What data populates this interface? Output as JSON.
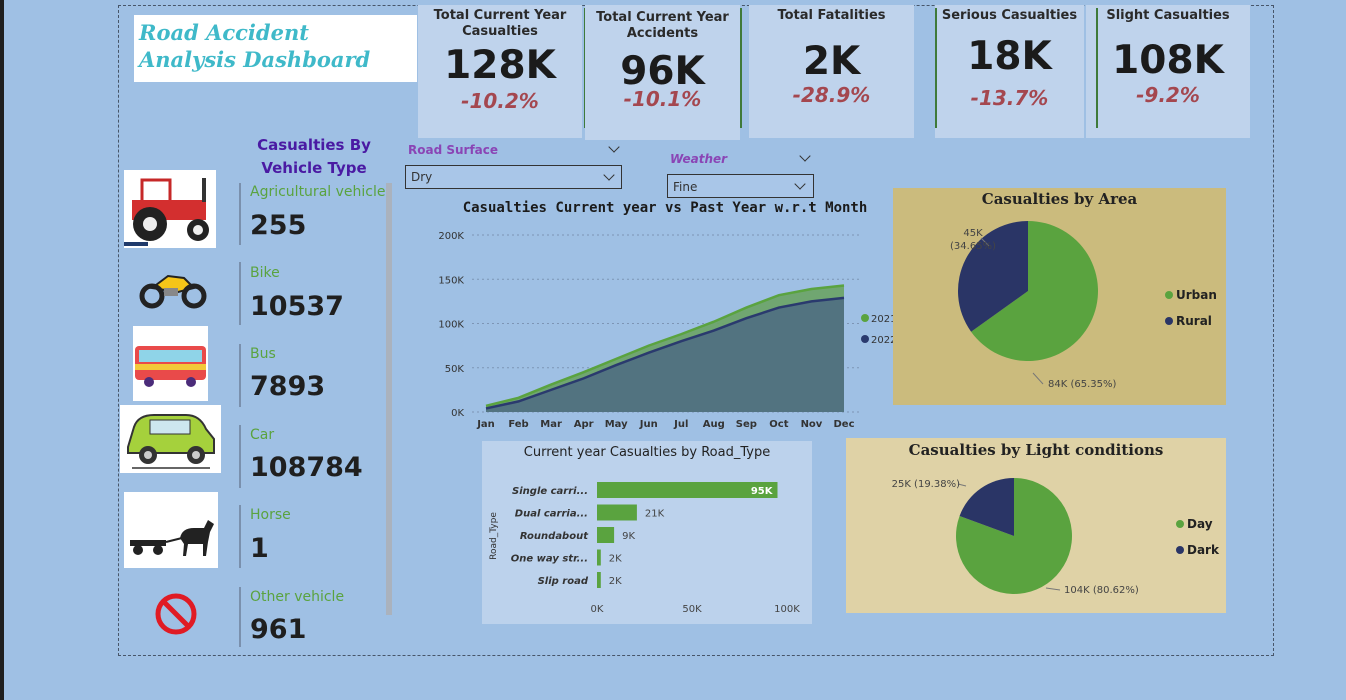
{
  "dashboard_title": "Road Accident Analysis Dashboard",
  "kpis": [
    {
      "label": "Total Current Year Casualties",
      "value": "128K",
      "change": "-10.2%"
    },
    {
      "label": "Total Current Year Accidents",
      "value": "96K",
      "change": "-10.1%"
    },
    {
      "label": "Total Fatalities",
      "value": "2K",
      "change": "-28.9%"
    },
    {
      "label": "Serious Casualties",
      "value": "18K",
      "change": "-13.7%"
    },
    {
      "label": "Slight Casualties",
      "value": "108K",
      "change": "-9.2%"
    }
  ],
  "vehicle_panel": {
    "title": "Casualties By Vehicle Type",
    "items": [
      {
        "name": "Agricultural vehicle",
        "value": "255",
        "icon": "tractor-icon"
      },
      {
        "name": "Bike",
        "value": "10537",
        "icon": "motorbike-icon"
      },
      {
        "name": "Bus",
        "value": "7893",
        "icon": "bus-icon"
      },
      {
        "name": "Car",
        "value": "108784",
        "icon": "car-icon"
      },
      {
        "name": "Horse",
        "value": "1",
        "icon": "horse-cart-icon"
      },
      {
        "name": "Other vehicle",
        "value": "961",
        "icon": "prohibited-icon"
      }
    ]
  },
  "filters": {
    "road_surface": {
      "label": "Road Surface",
      "selected": "Dry"
    },
    "weather": {
      "label": "Weather",
      "selected": "Fine"
    }
  },
  "colors": {
    "series_2021": "#5aa33f",
    "series_2022": "#2a3a6e",
    "urban": "#5aa33f",
    "rural": "#2a3566",
    "day": "#5aa33f",
    "dark": "#2a3566",
    "change_negative": "#a4474f"
  },
  "chart_data": [
    {
      "type": "area",
      "title": "Casualties Current year vs Past Year w.r.t Month",
      "categories": [
        "Jan",
        "Feb",
        "Mar",
        "Apr",
        "May",
        "Jun",
        "Jul",
        "Aug",
        "Sep",
        "Oct",
        "Nov",
        "Dec"
      ],
      "series": [
        {
          "name": "2021",
          "values": [
            7000,
            16000,
            31000,
            45000,
            60000,
            75000,
            88000,
            102000,
            118000,
            132000,
            139000,
            143000
          ]
        },
        {
          "name": "2022",
          "values": [
            4000,
            12000,
            25000,
            38000,
            53000,
            67000,
            80000,
            92000,
            106000,
            118000,
            125000,
            129000
          ]
        }
      ],
      "y_ticks": [
        "0K",
        "50K",
        "100K",
        "150K",
        "200K"
      ],
      "ylim": [
        0,
        200000
      ],
      "legend_position": "right",
      "grid": true
    },
    {
      "type": "pie",
      "title": "Casualties by Area",
      "slices": [
        {
          "label": "Urban",
          "value": 84000,
          "percent": 65.35,
          "data_label": "84K (65.35%)"
        },
        {
          "label": "Rural",
          "value": 45000,
          "percent": 34.65,
          "data_label": "45K (34.65%)"
        }
      ],
      "legend_position": "right"
    },
    {
      "type": "pie",
      "title": "Casualties by Light conditions",
      "slices": [
        {
          "label": "Day",
          "value": 104000,
          "percent": 80.62,
          "data_label": "104K (80.62%)"
        },
        {
          "label": "Dark",
          "value": 25000,
          "percent": 19.38,
          "data_label": "25K (19.38%)"
        }
      ],
      "legend_position": "right"
    },
    {
      "type": "bar",
      "orientation": "horizontal",
      "title": "Current year Casualties by Road_Type",
      "ylabel": "Road_Type",
      "categories": [
        "Single carri...",
        "Dual carria...",
        "Roundabout",
        "One way str...",
        "Slip road"
      ],
      "values": [
        95000,
        21000,
        9000,
        2000,
        2000
      ],
      "data_labels": [
        "95K",
        "21K",
        "9K",
        "2K",
        "2K"
      ],
      "x_ticks": [
        "0K",
        "50K",
        "100K"
      ],
      "xlim": [
        0,
        100000
      ]
    }
  ]
}
